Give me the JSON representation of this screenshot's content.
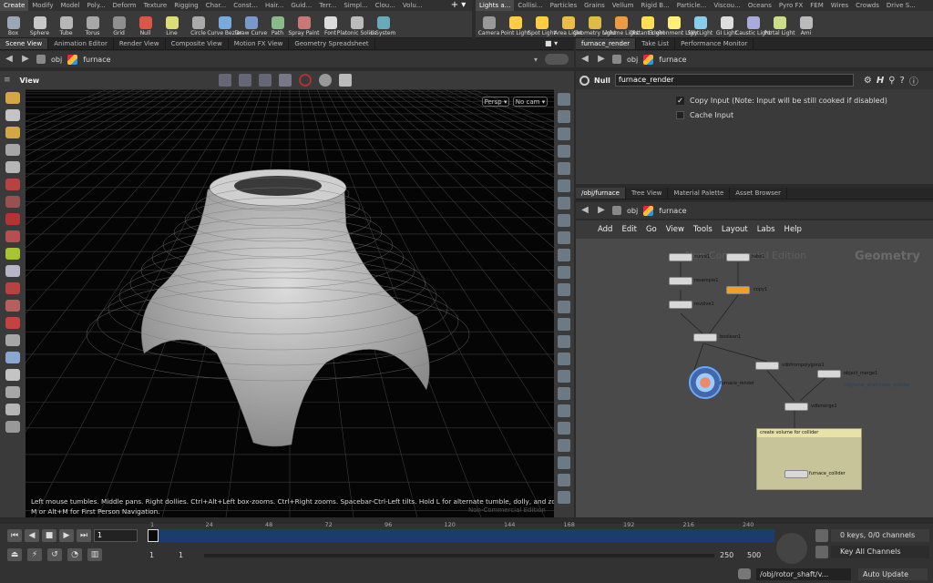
{
  "shelf_left": {
    "tabs": [
      "Create",
      "Modify",
      "Model",
      "Poly...",
      "Deform",
      "Texture",
      "Rigging",
      "Char...",
      "Const...",
      "Hair...",
      "Guid...",
      "Terr...",
      "Simpl...",
      "Clou...",
      "Volu..."
    ],
    "tools": [
      {
        "label": "Box",
        "color": "#9aa7b4"
      },
      {
        "label": "Sphere",
        "color": "#c8c8c8"
      },
      {
        "label": "Tube",
        "color": "#b7b7b7"
      },
      {
        "label": "Torus",
        "color": "#a8a8a8"
      },
      {
        "label": "Grid",
        "color": "#8f8f8f"
      },
      {
        "label": "Null",
        "color": "#d54"
      },
      {
        "label": "Line",
        "color": "#dd7"
      },
      {
        "label": "Circle",
        "color": "#aaa"
      },
      {
        "label": "Curve Bezier",
        "color": "#7ad"
      },
      {
        "label": "Draw Curve",
        "color": "#79c"
      },
      {
        "label": "Path",
        "color": "#8b8"
      },
      {
        "label": "Spray Paint",
        "color": "#c77"
      },
      {
        "label": "Font",
        "color": "#ddd"
      },
      {
        "label": "Platonic Solids",
        "color": "#bbb"
      },
      {
        "label": "L-System",
        "color": "#6ab"
      }
    ]
  },
  "shelf_right": {
    "tabs": [
      "Lights a...",
      "Collisi...",
      "Particles",
      "Grains",
      "Vellum",
      "Rigid B...",
      "Particle...",
      "Viscou...",
      "Oceans",
      "Pyro FX",
      "FEM",
      "Wires",
      "Crowds",
      "Drive S..."
    ],
    "tools": [
      {
        "label": "Camera",
        "color": "#999"
      },
      {
        "label": "Point Light",
        "color": "#fc4"
      },
      {
        "label": "Spot Light",
        "color": "#fc4"
      },
      {
        "label": "Area Light",
        "color": "#eb4"
      },
      {
        "label": "Geometry Light",
        "color": "#db4"
      },
      {
        "label": "Volume Light",
        "color": "#e94"
      },
      {
        "label": "Distant Light",
        "color": "#fd5"
      },
      {
        "label": "Environment Light",
        "color": "#fe7"
      },
      {
        "label": "Sky Light",
        "color": "#8ce"
      },
      {
        "label": "GI Light",
        "color": "#ddd"
      },
      {
        "label": "Caustic Light",
        "color": "#aad"
      },
      {
        "label": "Portal Light",
        "color": "#cd8"
      },
      {
        "label": "Ami",
        "color": "#bbb"
      }
    ]
  },
  "left_tabs": [
    "Scene View",
    "Animation Editor",
    "Render View",
    "Composite View",
    "Motion FX View",
    "Geometry Spreadsheet"
  ],
  "left_path": {
    "root": "obj",
    "node": "furnace"
  },
  "viewport": {
    "title": "View",
    "persp": "Persp ▾",
    "cam": "No cam ▾",
    "help1": "Left mouse tumbles. Middle pans. Right dollies. Ctrl+Alt+Left box-zooms. Ctrl+Right zooms. Spacebar-Ctrl-Left tilts. Hold L for alternate tumble, dolly, and zoom.",
    "help2": "M or Alt+M for First Person Navigation.",
    "watermark": "Non-Commercial Edition"
  },
  "right_top_tabs": [
    "furnace_render",
    "Take List",
    "Performance Monitor"
  ],
  "right_top_path": {
    "root": "obj",
    "node": "furnace"
  },
  "param": {
    "type": "Null",
    "name": "furnace_render",
    "copy_input": "Copy Input (Note: Input will be still cooked if disabled)",
    "cache_input": "Cache Input"
  },
  "right_bottom_tabs": [
    "/obj/furnace",
    "Tree View",
    "Material Palette",
    "Asset Browser"
  ],
  "right_bottom_path": {
    "root": "obj",
    "node": "furnace"
  },
  "net_menu": [
    "Add",
    "Edit",
    "Go",
    "View",
    "Tools",
    "Layout",
    "Labs",
    "Help"
  ],
  "net": {
    "watermark": "Non-Commercial Edition",
    "context": "Geometry",
    "nodes": {
      "curve1": "curve1",
      "tube1": "tube1",
      "resample1": "resample1",
      "copy1": "copy1",
      "revolve1": "revolve1",
      "boolean1": "boolean1",
      "furnace_render": "furnace_render",
      "vdbfrompolygons1": "vdbfrompolygons1",
      "object_merge1": "object_merge1",
      "merge_path": "/obj/rotor_shaft/rotor_collider",
      "vdbmerge1": "vdbmerge1",
      "furnace_collider": "furnace_collider"
    },
    "netbox": "create volume for collider"
  },
  "timeline": {
    "frame": "1",
    "ticks": [
      "1",
      "24",
      "48",
      "72",
      "96",
      "120",
      "144",
      "168",
      "192",
      "216",
      "240"
    ],
    "range_start": "1",
    "range_start2": "1",
    "range_end": "250",
    "range_end2": "500",
    "keys": "0 keys, 0/0 channels",
    "channels": "Key All Channels",
    "status_path": "/obj/rotor_shaft/v...",
    "update": "Auto Update"
  }
}
